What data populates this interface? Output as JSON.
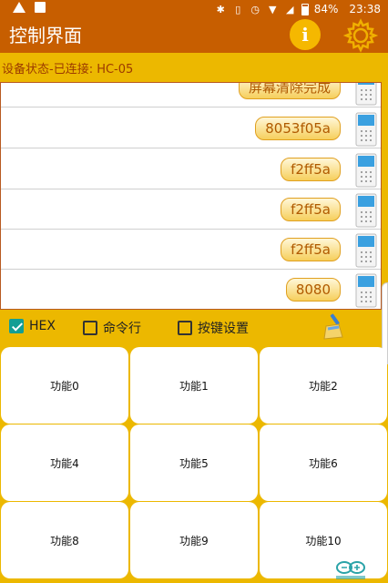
{
  "status_bar": {
    "battery": "84%",
    "time": "23:38"
  },
  "app_bar": {
    "title": "控制界面"
  },
  "device_status": "设备状态-已连接: HC-05",
  "messages": [
    "屏幕清除完成",
    "8053f05a",
    "f2ff5a",
    "f2ff5a",
    "f2ff5a",
    "8080"
  ],
  "options": {
    "hex": {
      "label": "HEX",
      "checked": true
    },
    "command_line": {
      "label": "命令行",
      "checked": false
    },
    "key_settings": {
      "label": "按键设置",
      "checked": false
    }
  },
  "functions": [
    "功能0",
    "功能1",
    "功能2",
    "功能4",
    "功能5",
    "功能6",
    "功能8",
    "功能9",
    "功能10"
  ],
  "colors": {
    "app_bar": "#c75e00",
    "background": "#ecb800",
    "checkbox_checked": "#129e94",
    "bubble_text": "#b05a00"
  }
}
